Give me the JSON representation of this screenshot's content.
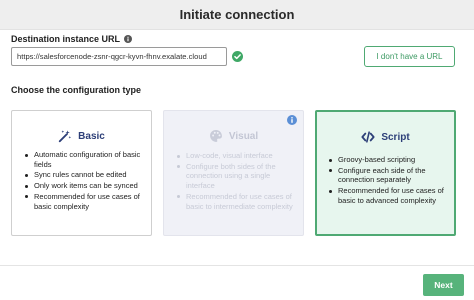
{
  "dialog": {
    "title": "Initiate connection"
  },
  "destination": {
    "label": "Destination instance URL",
    "info_icon": "info-icon",
    "url_value": "https://salesforcenode-zsnr-qgcr-kyvn-fhnv.exalate.cloud",
    "valid_icon": "check-circle-icon",
    "no_url_button": "I don't have a URL"
  },
  "configuration": {
    "label": "Choose the configuration type",
    "cards": [
      {
        "title": "Basic",
        "icon": "magic-wand-icon",
        "state": "default",
        "bullets": [
          "Automatic configuration of basic fields",
          "Sync rules cannot be edited",
          "Only work items can be synced",
          "Recommended for use cases of basic complexity"
        ]
      },
      {
        "title": "Visual",
        "icon": "palette-icon",
        "state": "disabled",
        "badge_icon": "info-icon",
        "bullets": [
          "Low-code, visual interface",
          "Configure both sides of the connection using a single interface",
          "Recommended for use cases of basic to intermediate complexity"
        ]
      },
      {
        "title": "Script",
        "icon": "code-icon",
        "state": "selected",
        "bullets": [
          "Groovy-based scripting",
          "Configure each side of the connection separately",
          "Recommended for use cases of basic to advanced complexity"
        ]
      }
    ]
  },
  "footer": {
    "next_button": "Next"
  },
  "colors": {
    "accent_green": "#57b37b",
    "title_navy": "#2d3f78",
    "selected_bg": "#e7f6ee",
    "disabled_bg": "#f0f1f7",
    "info_blue": "#5b8fd6"
  }
}
